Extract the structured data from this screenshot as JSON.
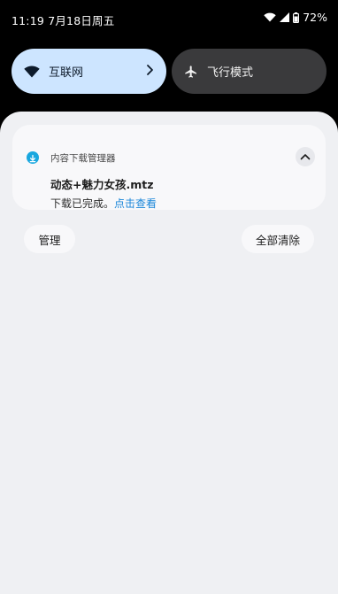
{
  "status_bar": {
    "time": "11:19 7月18日周五",
    "battery": "72%",
    "icons": [
      "wifi-icon",
      "signal-icon",
      "battery-icon"
    ]
  },
  "quick_settings": {
    "tiles": [
      {
        "label": "互联网",
        "icon": "wifi-icon"
      },
      {
        "label": "飞行模式",
        "icon": "airplane-icon"
      }
    ]
  },
  "notification": {
    "app_name": "内容下载管理器",
    "app_icon": "download-icon",
    "title": "动态+魅力女孩.mtz",
    "body_text": "下载已完成。",
    "body_link": "点击查看"
  },
  "actions": {
    "manage": "管理",
    "clear_all": "全部清除"
  },
  "colors": {
    "internet_tile": "#cde5ff",
    "airplane_tile": "#3a3a3c",
    "sheet_bg": "#eff0f3",
    "link": "#1a86d9",
    "app_icon": "#19a7df"
  }
}
